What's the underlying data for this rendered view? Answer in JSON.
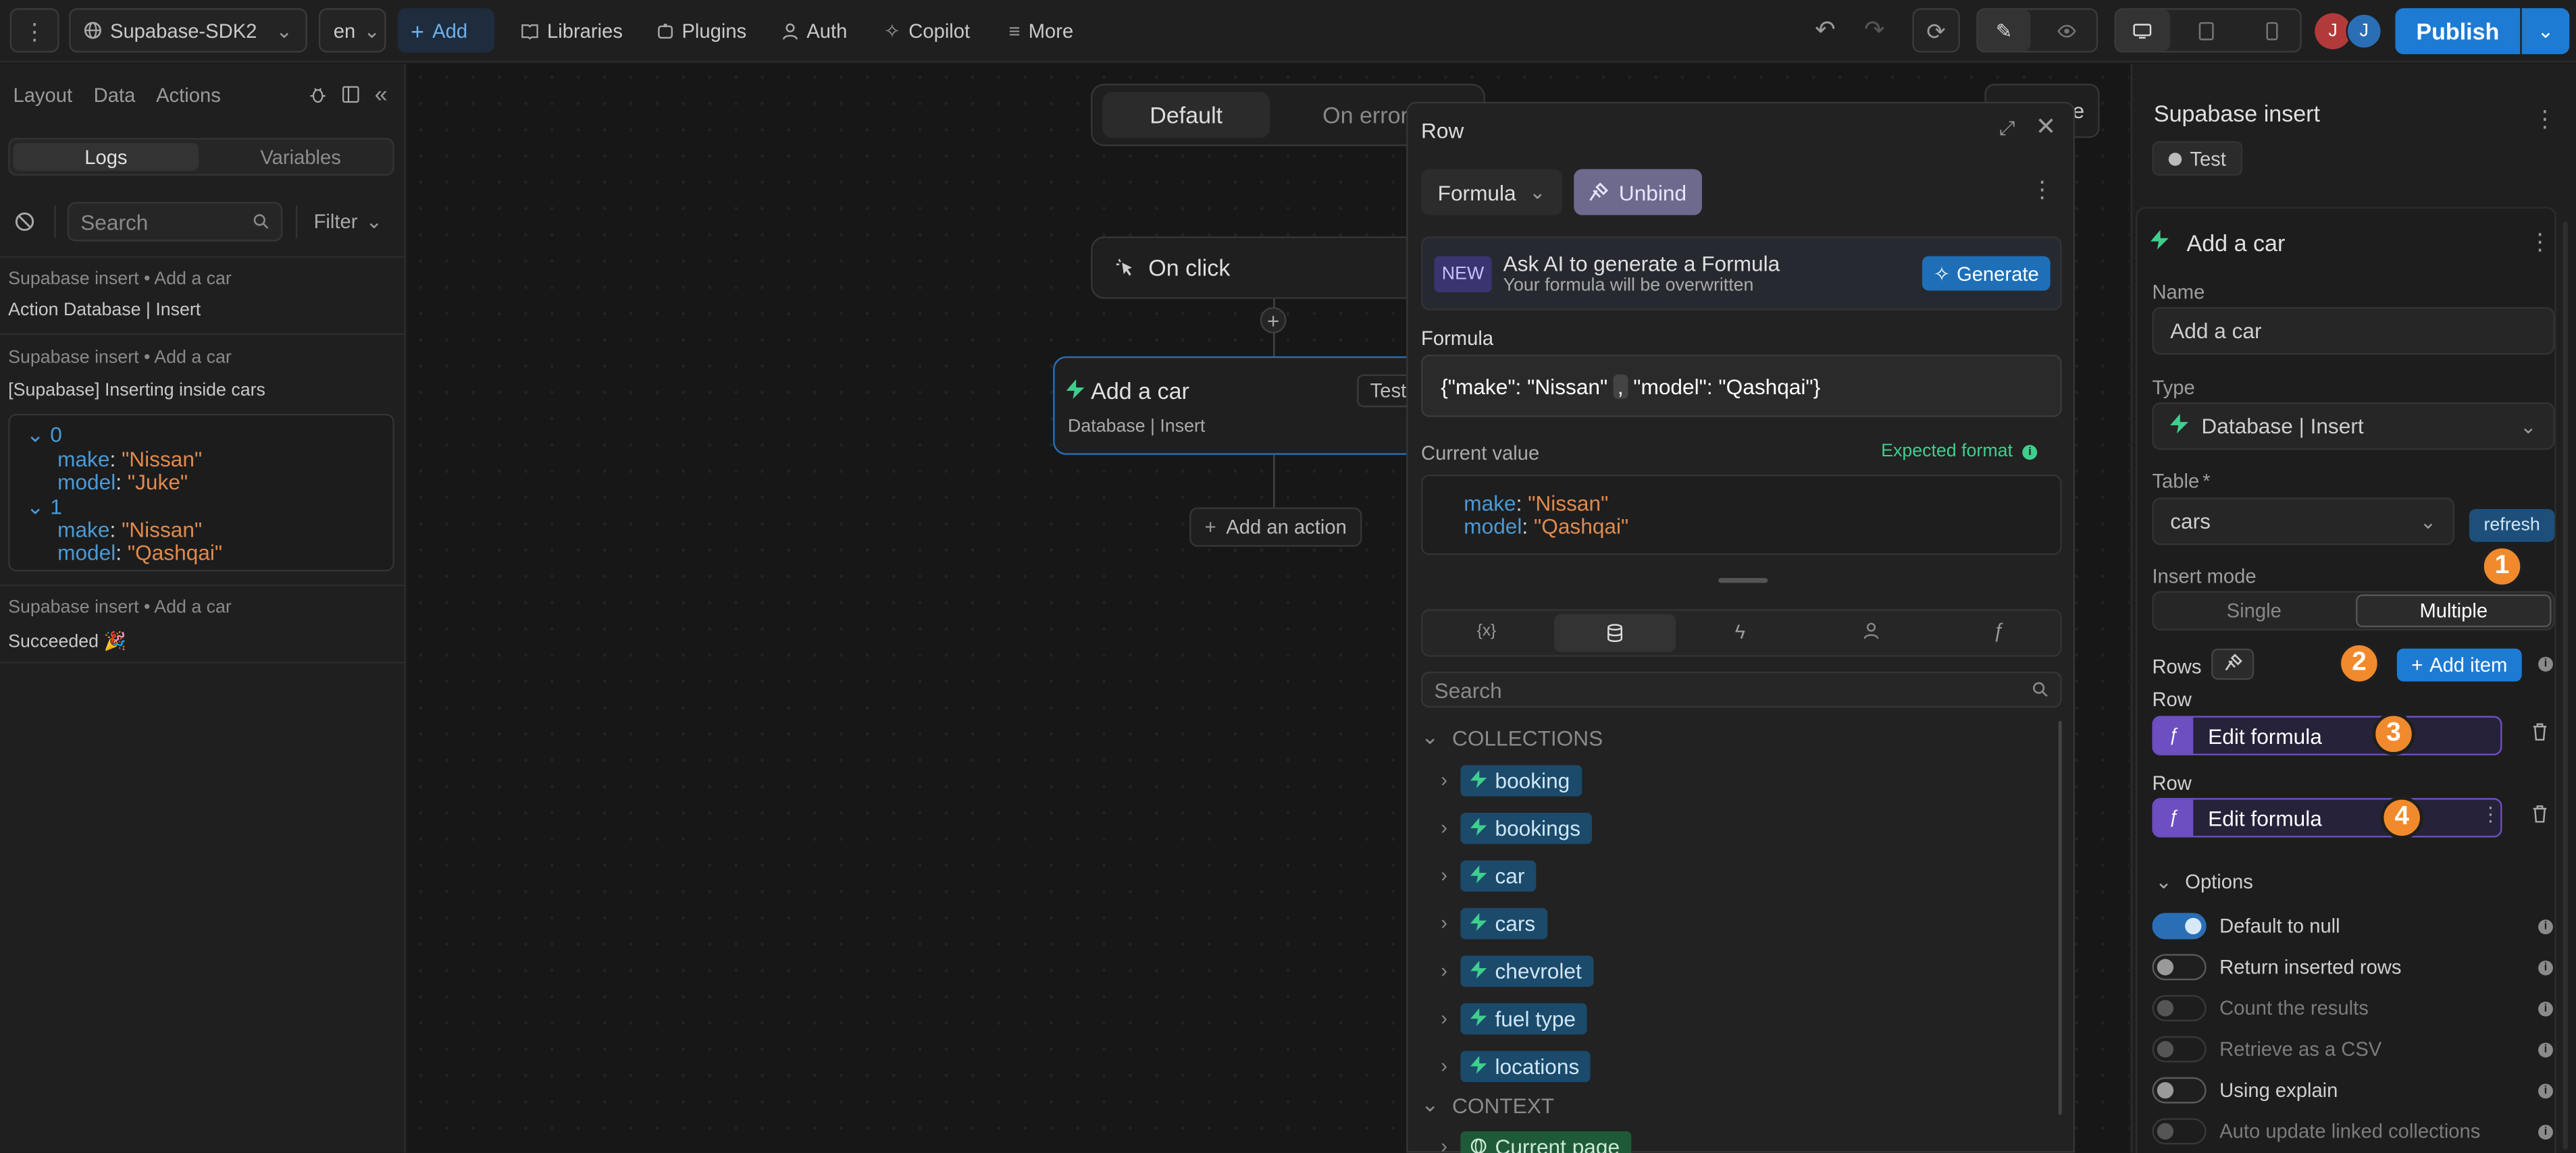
{
  "topbar": {
    "project": "Supabase-SDK2",
    "lang": "en",
    "add": "Add",
    "libraries": "Libraries",
    "plugins": "Plugins",
    "auth": "Auth",
    "copilot": "Copilot",
    "more": "More",
    "avatar1": "J",
    "avatar2": "J",
    "publish": "Publish"
  },
  "left": {
    "tabs": [
      "Layout",
      "Data",
      "Actions"
    ],
    "seg": [
      "Logs",
      "Variables"
    ],
    "search_placeholder": "Search",
    "filter": "Filter",
    "logs": [
      {
        "head": "Supabase insert • Add a car",
        "text": "Action Database | Insert"
      },
      {
        "head": "Supabase insert • Add a car",
        "text": "[Supabase] Inserting inside cars"
      },
      {
        "head": "Supabase insert • Add a car",
        "text": "Succeeded 🎉"
      }
    ],
    "tree": {
      "idx0": "0",
      "idx1": "1",
      "make_key": "make",
      "model_key": "model",
      "make0": "\"Nissan\"",
      "model0": "\"Juke\"",
      "make1": "\"Nissan\"",
      "model1": "\"Qashqai\""
    }
  },
  "canvas": {
    "tab_default": "Default",
    "tab_error": "On error",
    "trigger": "On click",
    "action_title": "Add a car",
    "action_sub": "Database | Insert",
    "action_test": "Test",
    "add_action": "Add an action",
    "close_partial": "se"
  },
  "popup": {
    "title": "Row",
    "formula_btn": "Formula",
    "unbind_btn": "Unbind",
    "ai_badge": "NEW",
    "ai_title": "Ask AI to generate a Formula",
    "ai_sub": "Your formula will be overwritten",
    "generate": "Generate",
    "formula_label": "Formula",
    "formula_a": "{\"make\": \"Nissan\"",
    "formula_sep": ",",
    "formula_b": "\"model\": \"Qashqai\"}",
    "current_value": "Current value",
    "expected_format": "Expected format",
    "cv_make_key": "make",
    "cv_make_val": "\"Nissan\"",
    "cv_model_key": "model",
    "cv_model_val": "\"Qashqai\"",
    "search_placeholder": "Search",
    "collections_header": "COLLECTIONS",
    "collections": [
      "booking",
      "bookings",
      "car",
      "cars",
      "chevrolet",
      "fuel type",
      "locations"
    ],
    "context_header": "CONTEXT",
    "context_item": "Current page"
  },
  "right": {
    "header": "Supabase insert",
    "test": "Test",
    "action_name": "Add a car",
    "name_label": "Name",
    "name_value": "Add a car",
    "type_label": "Type",
    "type_value": "Database | Insert",
    "table_label": "Table",
    "table_required": "*",
    "table_value": "cars",
    "refresh": "refresh",
    "insert_mode_label": "Insert mode",
    "mode_single": "Single",
    "mode_multiple": "Multiple",
    "rows_label": "Rows",
    "add_item": "Add item",
    "row_label_1": "Row",
    "row_label_2": "Row",
    "edit_formula_1": "Edit formula",
    "edit_formula_2": "Edit formula",
    "badges": [
      "1",
      "2",
      "3",
      "4"
    ],
    "options_label": "Options",
    "options": [
      {
        "label": "Default to null",
        "on": true,
        "dim": false
      },
      {
        "label": "Return inserted rows",
        "on": false,
        "dim": false
      },
      {
        "label": "Count the results",
        "on": false,
        "dim": true
      },
      {
        "label": "Retrieve as a CSV",
        "on": false,
        "dim": true
      },
      {
        "label": "Using explain",
        "on": false,
        "dim": false
      },
      {
        "label": "Auto update linked collections",
        "on": false,
        "dim": true
      }
    ]
  },
  "colors": {
    "accent": "#1e7bd3",
    "badge": "#f08a2c",
    "chip_blue": "#1b4a6b",
    "chip_green": "#1f5a38",
    "formula_purple": "#6d4fc2"
  }
}
